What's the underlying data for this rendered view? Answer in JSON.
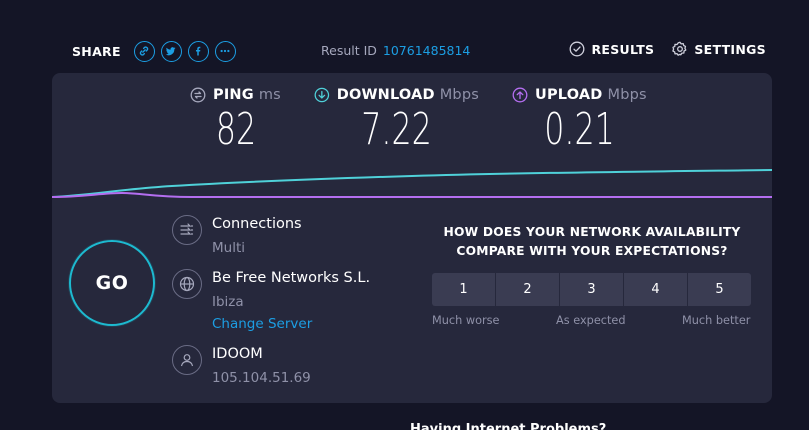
{
  "header": {
    "share_label": "SHARE",
    "share_icons": [
      "link-icon",
      "twitter-icon",
      "facebook-icon",
      "more-icon"
    ],
    "result_label": "Result ID",
    "result_id": "10761485814",
    "results_label": "RESULTS",
    "settings_label": "SETTINGS"
  },
  "metrics": {
    "ping": {
      "label": "PING",
      "unit": "ms",
      "value": "82"
    },
    "download": {
      "label": "DOWNLOAD",
      "unit": "Mbps",
      "value": "7.22"
    },
    "upload": {
      "label": "UPLOAD",
      "unit": "Mbps",
      "value": "0.21"
    }
  },
  "go_label": "GO",
  "connections": {
    "title": "Connections",
    "value": "Multi"
  },
  "server": {
    "name": "Be Free Networks S.L.",
    "location": "Ibiza",
    "change_label": "Change Server"
  },
  "isp": {
    "name": "IDOOM",
    "ip": "105.104.51.69"
  },
  "survey": {
    "question_line1": "HOW DOES YOUR NETWORK AVAILABILITY",
    "question_line2": "COMPARE WITH YOUR EXPECTATIONS?",
    "options": [
      "1",
      "2",
      "3",
      "4",
      "5"
    ],
    "low_label": "Much worse",
    "mid_label": "As expected",
    "high_label": "Much better"
  },
  "footer_partial": "Having Internet Problems?",
  "colors": {
    "background": "#141526",
    "panel": "#26283c",
    "accent_blue": "#1c9ee3",
    "download_cyan": "#4fd1d9",
    "upload_purple": "#b46ef0",
    "go_ring": "#1dbad0"
  }
}
